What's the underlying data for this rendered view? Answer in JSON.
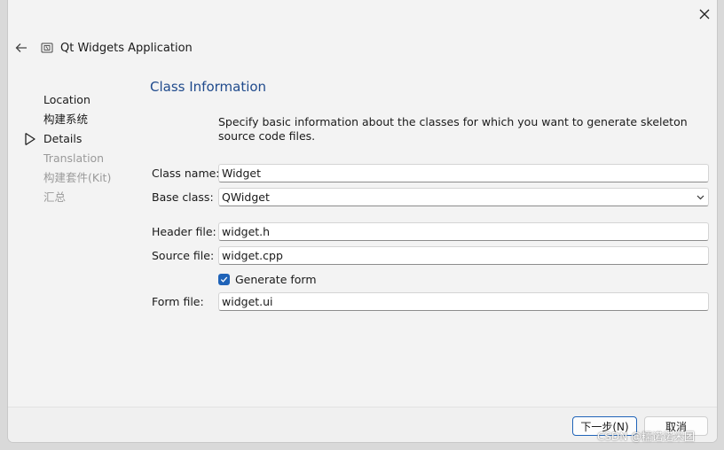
{
  "header": {
    "title": "Qt Widgets Application"
  },
  "steps": [
    {
      "label": "Location",
      "state": "done"
    },
    {
      "label": "构建系统",
      "state": "done"
    },
    {
      "label": "Details",
      "state": "current"
    },
    {
      "label": "Translation",
      "state": "future"
    },
    {
      "label": "构建套件(Kit)",
      "state": "future"
    },
    {
      "label": "汇总",
      "state": "future"
    }
  ],
  "page": {
    "title": "Class Information",
    "intro": "Specify basic information about the classes for which you want to generate skeleton source code files."
  },
  "form": {
    "class_name": {
      "label": "Class name:",
      "value": "Widget"
    },
    "base_class": {
      "label": "Base class:",
      "value": "QWidget"
    },
    "header_file": {
      "label": "Header file:",
      "value": "widget.h"
    },
    "source_file": {
      "label": "Source file:",
      "value": "widget.cpp"
    },
    "generate_form": {
      "label": "Generate form",
      "checked": true
    },
    "form_file": {
      "label": "Form file:",
      "value": "widget.ui"
    }
  },
  "footer": {
    "next_label": "下一步(N)",
    "cancel_label": "取消"
  },
  "watermark": "CSDN @糯诺诺米团",
  "colors": {
    "accent": "#1f63b8",
    "title": "#1f4a8c",
    "muted": "#9a9a9a"
  }
}
